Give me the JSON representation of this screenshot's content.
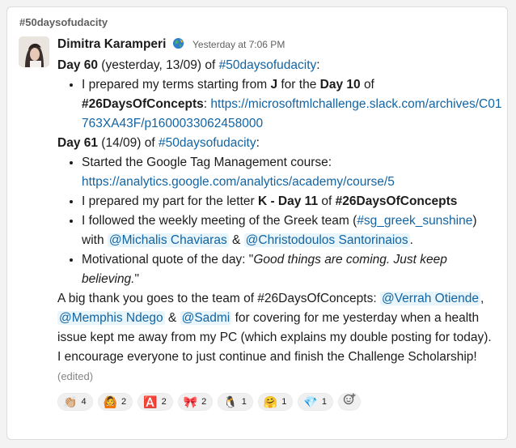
{
  "channel": "#50daysofudacity",
  "author": {
    "name": "Dimitra Karamperi",
    "status_icon": "globe-icon",
    "timestamp": "Yesterday at 7:06 PM"
  },
  "message": {
    "day60": {
      "label": "Day 60",
      "paren": "(yesterday, 13/09) of",
      "hashtag": "#50daysofudacity",
      "colon": ":",
      "bullet1": {
        "text1": "I prepared my terms starting from",
        "letter": "J",
        "text2": "for the",
        "day": "Day 10",
        "text3": "of",
        "concepts": "#26DaysOfConcepts",
        "colon": ":",
        "link": "https://microsoftmlchallenge.slack.com/archives/C01763XA43F/p1600033062458000"
      }
    },
    "day61": {
      "label": "Day 61",
      "paren": "(14/09) of",
      "hashtag": "#50daysofudacity",
      "colon": ":",
      "bullet1": {
        "text": "Started the Google Tag Management course:",
        "link": "https://analytics.google.com/analytics/academy/course/5"
      },
      "bullet2": {
        "text1": "I prepared my part for the letter",
        "letter_day": "K - Day 11",
        "text2": "of",
        "concepts": "#26DaysOfConcepts"
      },
      "bullet3": {
        "text1": "I followed the weekly meeting of the Greek team (",
        "channel": "#sg_greek_sunshine",
        "text2": ")",
        "with": "with",
        "mention1": "@Michalis Chaviaras",
        "amp": "&",
        "mention2": "@Christodoulos Santorinaios",
        "period": "."
      },
      "bullet4": {
        "text": "Motivational quote of the day: \"",
        "quote": "Good things are coming. Just keep believing.",
        "close": "\""
      }
    },
    "thanks": {
      "text1": "A big thank you goes to the team of #26DaysOfConcepts:",
      "mention1": "@Verrah Otiende",
      "comma": ",",
      "mention2": "@Memphis Ndego",
      "amp": "&",
      "mention3": "@Sadmi",
      "text2": "for covering for me yesterday when a health issue kept me away from my PC (which explains my double posting for today)."
    },
    "encourage": {
      "text": "I encourage everyone to just continue and finish the Challenge Scholarship!",
      "edited": "(edited)"
    }
  },
  "reactions": [
    {
      "emoji": "👏🏼",
      "icon": "clapping-hands-icon",
      "count": "4"
    },
    {
      "emoji": "🙆",
      "icon": "person-gesturing-ok-icon",
      "count": "2"
    },
    {
      "emoji": "🅰️",
      "icon": "alpha-badge-icon",
      "count": "2"
    },
    {
      "emoji": "🎀",
      "icon": "ribbon-icon",
      "count": "2"
    },
    {
      "emoji": "🐧",
      "icon": "penguin-icon",
      "count": "1"
    },
    {
      "emoji": "🤗",
      "icon": "hugging-face-icon",
      "count": "1"
    },
    {
      "emoji": "💎",
      "icon": "gem-icon",
      "count": "1"
    }
  ],
  "add_reaction_icon": "add-reaction-icon",
  "colors": {
    "link": "#1264a3",
    "mention_bg": "#e8f5fa",
    "text": "#1d1c1d",
    "muted": "#616061"
  }
}
